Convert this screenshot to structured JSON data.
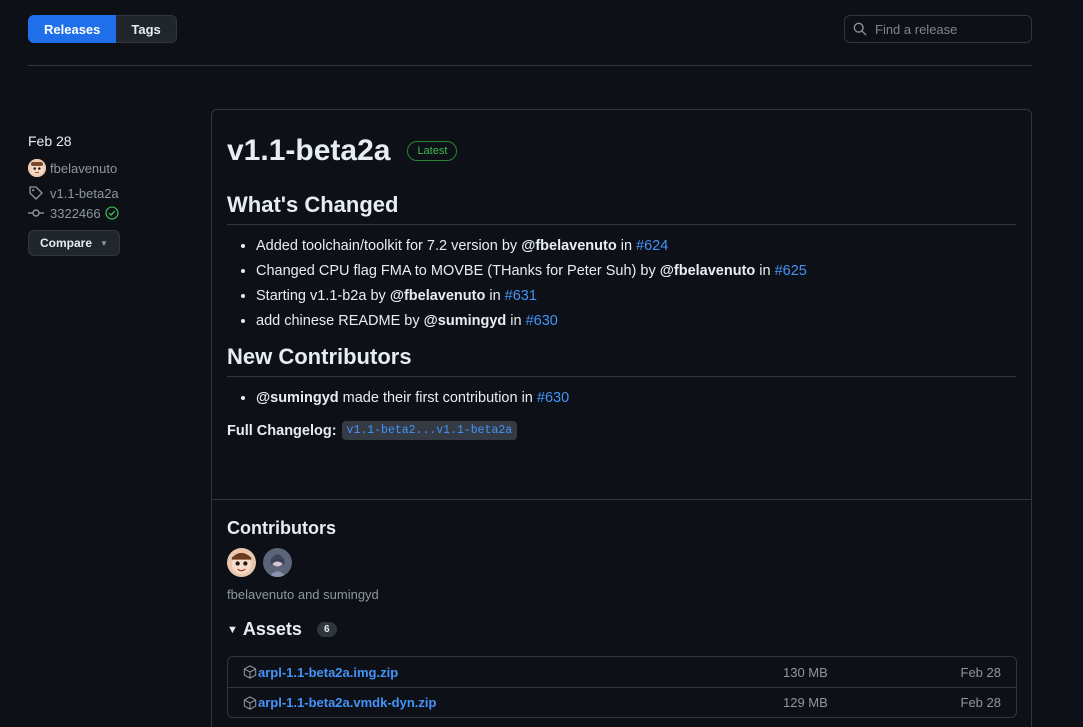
{
  "tabs": {
    "releases": "Releases",
    "tags": "Tags"
  },
  "search": {
    "placeholder": "Find a release"
  },
  "meta": {
    "date": "Feb 28",
    "author": "fbelavenuto",
    "tag": "v1.1-beta2a",
    "commit": "3322466",
    "compare_label": "Compare"
  },
  "release": {
    "title": "v1.1-beta2a",
    "badge": "Latest",
    "whats_changed_heading": "What's Changed",
    "changes": [
      {
        "text": "Added toolchain/toolkit for 7.2 version by ",
        "user": "@fbelavenuto",
        "in": " in ",
        "pr": "#624"
      },
      {
        "text": "Changed CPU flag FMA to MOVBE (THanks for Peter Suh) by ",
        "user": "@fbelavenuto",
        "in": " in ",
        "pr": "#625"
      },
      {
        "text": "Starting v1.1-b2a by ",
        "user": "@fbelavenuto",
        "in": " in ",
        "pr": "#631"
      },
      {
        "text": "add chinese README by ",
        "user": "@sumingyd",
        "in": " in ",
        "pr": "#630"
      }
    ],
    "new_contributors_heading": "New Contributors",
    "new_contributors": [
      {
        "user": "@sumingyd",
        "text": " made their first contribution in ",
        "pr": "#630"
      }
    ],
    "full_changelog_label": "Full Changelog:",
    "full_changelog_link": "v1.1-beta2...v1.1-beta2a"
  },
  "contributors": {
    "heading": "Contributors",
    "names": "fbelavenuto and sumingyd"
  },
  "assets": {
    "heading": "Assets",
    "count": "6",
    "items": [
      {
        "name": "arpl-1.1-beta2a.img.zip",
        "size": "130 MB",
        "date": "Feb 28"
      },
      {
        "name": "arpl-1.1-beta2a.vmdk-dyn.zip",
        "size": "129 MB",
        "date": "Feb 28"
      }
    ]
  },
  "colors": {
    "accent": "#1f6feb",
    "link": "#4493f8",
    "success": "#3fb950",
    "background": "#0d1117",
    "border": "#30363d"
  }
}
